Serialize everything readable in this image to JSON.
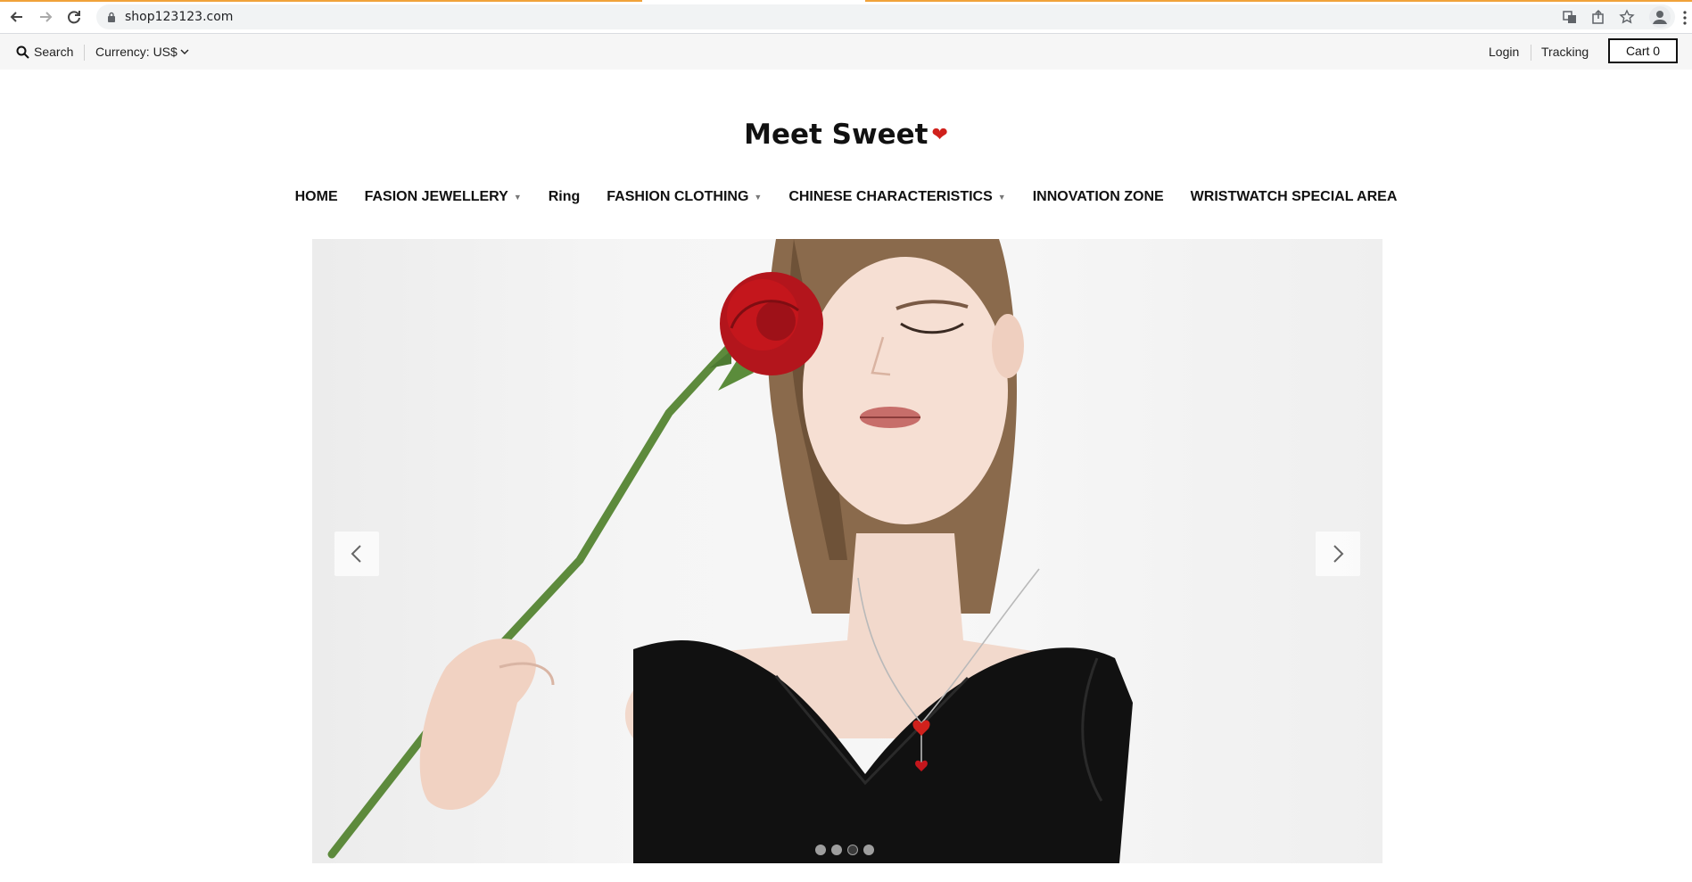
{
  "browser": {
    "url": "shop123123.com"
  },
  "utility_bar": {
    "search_label": "Search",
    "currency_label": "Currency: US$",
    "login_label": "Login",
    "tracking_label": "Tracking",
    "cart_label": "Cart 0"
  },
  "brand": {
    "name": "Meet Sweet",
    "heart": "❤",
    "heart_color": "#d0211c"
  },
  "nav": {
    "items": [
      {
        "label": "HOME",
        "has_dropdown": false
      },
      {
        "label": "FASION JEWELLERY",
        "has_dropdown": true
      },
      {
        "label": "Ring",
        "has_dropdown": false
      },
      {
        "label": "FASHION CLOTHING",
        "has_dropdown": true
      },
      {
        "label": "CHINESE CHARACTERISTICS",
        "has_dropdown": true
      },
      {
        "label": "INNOVATION ZONE",
        "has_dropdown": false
      },
      {
        "label": "WRISTWATCH SPECIAL AREA",
        "has_dropdown": false
      }
    ],
    "caret": "▼"
  },
  "hero": {
    "slide_count": 4,
    "active_slide": 3,
    "prev_icon": "chevron-left-icon",
    "next_icon": "chevron-right-icon"
  },
  "colors": {
    "accent_load_bar": "#f0a23a",
    "rose_red": "#c4161c",
    "dress_black": "#111111"
  }
}
